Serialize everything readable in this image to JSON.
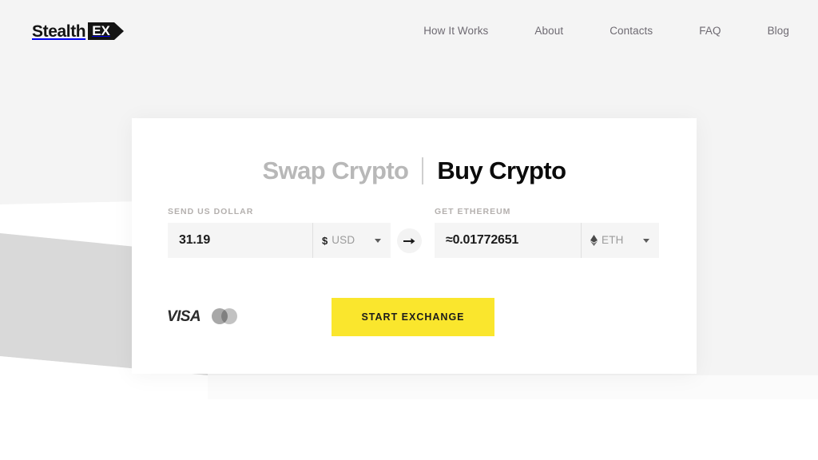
{
  "brand": {
    "word": "Stealth",
    "tag": "EX"
  },
  "nav": {
    "items": [
      {
        "label": "How It Works"
      },
      {
        "label": "About"
      },
      {
        "label": "Contacts"
      },
      {
        "label": "FAQ"
      },
      {
        "label": "Blog"
      }
    ]
  },
  "card": {
    "tabs": [
      {
        "label": "Swap Crypto",
        "active": false
      },
      {
        "label": "Buy Crypto",
        "active": true
      }
    ],
    "send": {
      "label": "SEND US DOLLAR",
      "amount": "31.19",
      "placeholder": "Amount",
      "currency_symbol": "$",
      "currency_code": "USD",
      "currency_icon": "dollar-sign-icon"
    },
    "get": {
      "label": "GET ETHEREUM",
      "amount": "≈0.01772651",
      "placeholder": "Amount",
      "currency_symbol": "♦",
      "currency_code": "ETH",
      "currency_icon": "ethereum-icon"
    },
    "swap_arrow_icon": "arrow-right-icon",
    "payment_methods": [
      {
        "name": "visa-logo",
        "label": "VISA"
      },
      {
        "name": "mastercard-logo",
        "label": ""
      }
    ],
    "cta": {
      "label": "START EXCHANGE"
    }
  },
  "colors": {
    "page_background": "#f4f4f4",
    "card_background": "#ffffff",
    "accent_yellow": "#fae62d",
    "input_background": "#f5f5f5",
    "shape_gray": "#d9d9d9",
    "text_dark": "#0b0b0b",
    "text_muted": "#b8b8b8",
    "nav_text": "#6e6a72"
  }
}
